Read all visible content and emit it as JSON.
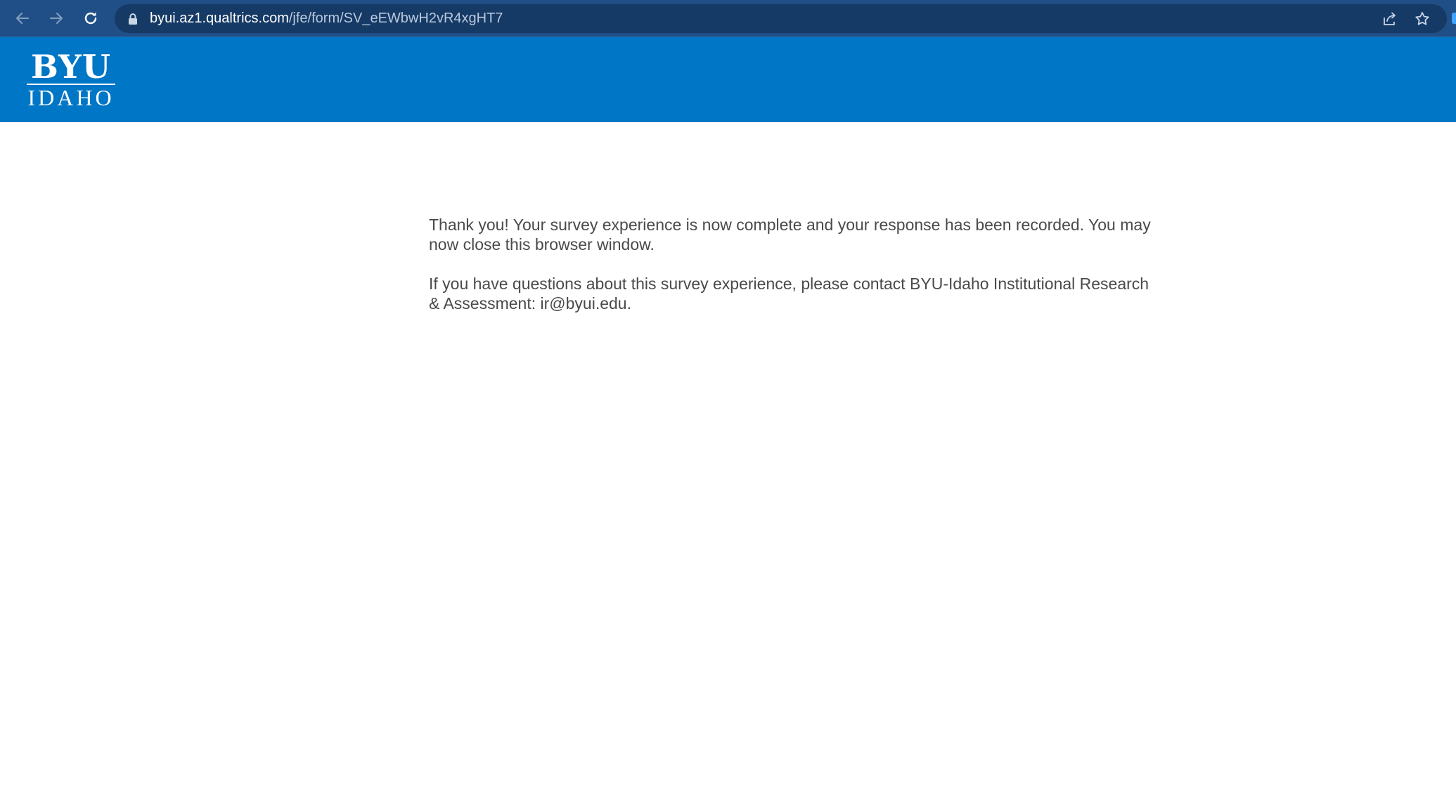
{
  "browser": {
    "url_host": "byui.az1.qualtrics.com",
    "url_path": "/jfe/form/SV_eEWbwH2vR4xgHT7",
    "icons": {
      "back": "arrow-left-icon",
      "forward": "arrow-right-icon",
      "reload": "reload-icon",
      "lock": "lock-icon",
      "share": "share-icon",
      "bookmark": "star-icon"
    }
  },
  "header": {
    "brand_color": "#0076c6",
    "logo_top": "BYU",
    "logo_bottom": "IDAHO"
  },
  "main": {
    "message_1": "Thank you! Your survey experience is now complete and your response has been recorded. You may now close this browser window.",
    "message_2": "If you have questions about this survey experience, please contact BYU-Idaho Institutional Research & Assessment: ir@byui.edu."
  }
}
